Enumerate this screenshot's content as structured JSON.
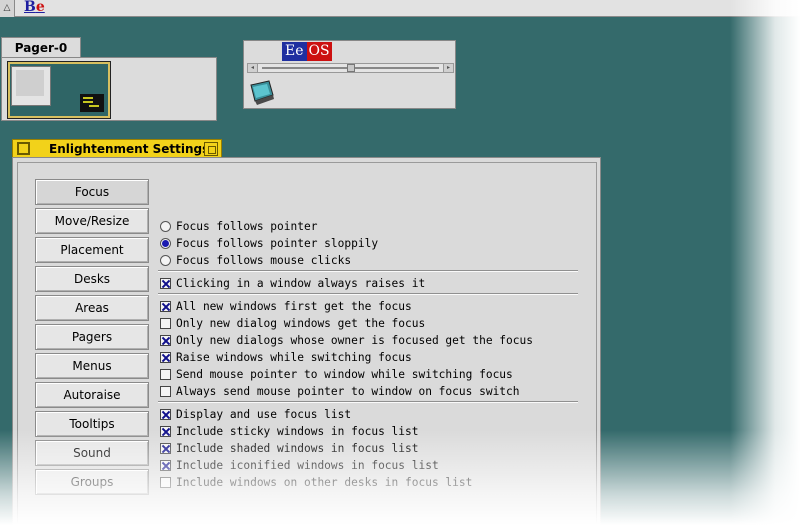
{
  "topbar": {
    "menu_arrow": "△",
    "logo_b": "B",
    "logo_e": "e"
  },
  "pager": {
    "tab_label": "Pager-0"
  },
  "mini_window": {
    "logo_left": "Ee",
    "logo_right": "OS"
  },
  "settings": {
    "title": "Enlightenment Settings",
    "sidebar": [
      "Focus",
      "Move/Resize",
      "Placement",
      "Desks",
      "Areas",
      "Pagers",
      "Menus",
      "Autoraise",
      "Tooltips",
      "Sound",
      "Groups"
    ],
    "focus_mode": {
      "options": [
        "Focus follows pointer",
        "Focus follows pointer sloppily",
        "Focus follows mouse clicks"
      ],
      "selected": 1
    },
    "options": [
      {
        "label": "Clicking in a window always raises it",
        "checked": true
      },
      {
        "label": "All new windows first get the focus",
        "checked": true
      },
      {
        "label": "Only new dialog windows get the focus",
        "checked": false
      },
      {
        "label": "Only new dialogs whose owner is focused get the focus",
        "checked": true
      },
      {
        "label": "Raise windows while switching focus",
        "checked": true
      },
      {
        "label": "Send mouse pointer to window while switching focus",
        "checked": false
      },
      {
        "label": "Always send mouse pointer to window on focus switch",
        "checked": false
      },
      {
        "label": "Display and use focus list",
        "checked": true
      },
      {
        "label": "Include sticky windows in focus list",
        "checked": true
      },
      {
        "label": "Include shaded windows in focus list",
        "checked": true
      },
      {
        "label": "Include iconified windows in focus list",
        "checked": true
      },
      {
        "label": "Include windows on other desks in focus list",
        "checked": false
      }
    ]
  },
  "colors": {
    "desktop": "#346a6b",
    "titlebar": "#f2d21a",
    "check_mark": "#10108c"
  }
}
